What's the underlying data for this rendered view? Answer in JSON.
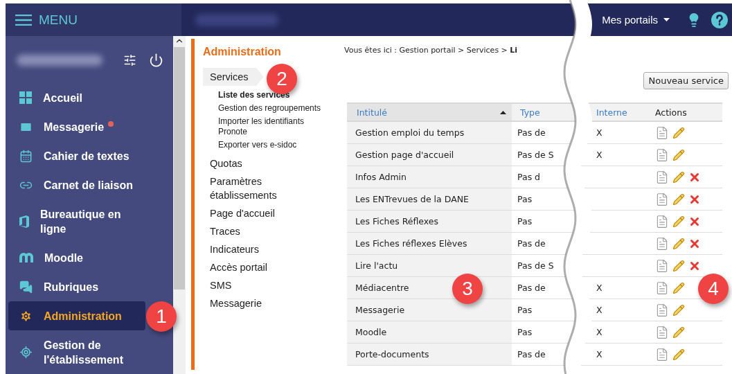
{
  "topbar": {
    "menu_label": "MENU",
    "portals_label": "Mes portails"
  },
  "sidebar": {
    "items": [
      {
        "label": "Accueil",
        "selected": false,
        "notification": false
      },
      {
        "label": "Messagerie",
        "selected": false,
        "notification": true
      },
      {
        "label": "Cahier de textes",
        "selected": false,
        "notification": false
      },
      {
        "label": "Carnet de liaison",
        "selected": false,
        "notification": false
      },
      {
        "label": "Bureautique en ligne",
        "selected": false,
        "notification": false
      },
      {
        "label": "Moodle",
        "selected": false,
        "notification": false
      },
      {
        "label": "Rubriques",
        "selected": false,
        "notification": false
      },
      {
        "label": "Administration",
        "selected": true,
        "notification": false
      },
      {
        "label": "Gestion de l'établissement",
        "selected": false,
        "notification": false
      }
    ]
  },
  "admin_nav": {
    "title": "Administration",
    "items": [
      {
        "label": "Services",
        "selected": true,
        "children": [
          {
            "label": "Liste des services",
            "selected": true
          },
          {
            "label": "Gestion des regroupements",
            "selected": false
          },
          {
            "label": "Importer les identifiants Pronote",
            "selected": false
          },
          {
            "label": "Exporter vers e-sidoc",
            "selected": false
          }
        ]
      },
      {
        "label": "Quotas",
        "selected": false
      },
      {
        "label": "Paramètres établissements",
        "selected": false
      },
      {
        "label": "Page d'accueil",
        "selected": false
      },
      {
        "label": "Traces",
        "selected": false
      },
      {
        "label": "Indicateurs",
        "selected": false
      },
      {
        "label": "Accès portail",
        "selected": false
      },
      {
        "label": "SMS",
        "selected": false
      },
      {
        "label": "Messagerie",
        "selected": false
      }
    ]
  },
  "breadcrumb": "Vous êtes ici : Gestion portail > Services > **Li**",
  "new_button": "Nouveau service",
  "table": {
    "columns": [
      "Intitulé",
      "Type",
      "Interne",
      "Actions"
    ],
    "rows": [
      {
        "title": "Gestion emploi du temps",
        "type": "Pas de",
        "internal": "X",
        "deletable": false
      },
      {
        "title": "Gestion page d'accueil",
        "type": "Pas de S",
        "internal": "X",
        "deletable": false
      },
      {
        "title": "Infos Admin",
        "type": "Pas d",
        "deletable": true
      },
      {
        "title": "Les ENTrevues de la DANE",
        "type": "Pas",
        "deletable": true
      },
      {
        "title": "Les Fiches Réflexes",
        "type": "Pas",
        "deletable": true
      },
      {
        "title": "Les Fiches réflexes Elèves",
        "type": "Pas de",
        "deletable": true
      },
      {
        "title": "Lire l'actu",
        "type": "Pas de S",
        "deletable": true
      },
      {
        "title": "Médiacentre",
        "type": "Pas de",
        "internal": "X",
        "deletable": false
      },
      {
        "title": "Messagerie",
        "type": "Pas",
        "internal": "X",
        "deletable": false
      },
      {
        "title": "Moodle",
        "type": "Pas",
        "internal": "X",
        "deletable": false
      },
      {
        "title": "Porte-documents",
        "type": "Pas de",
        "internal": "X",
        "deletable": false
      }
    ]
  },
  "callouts": [
    "1",
    "2",
    "3",
    "4"
  ]
}
